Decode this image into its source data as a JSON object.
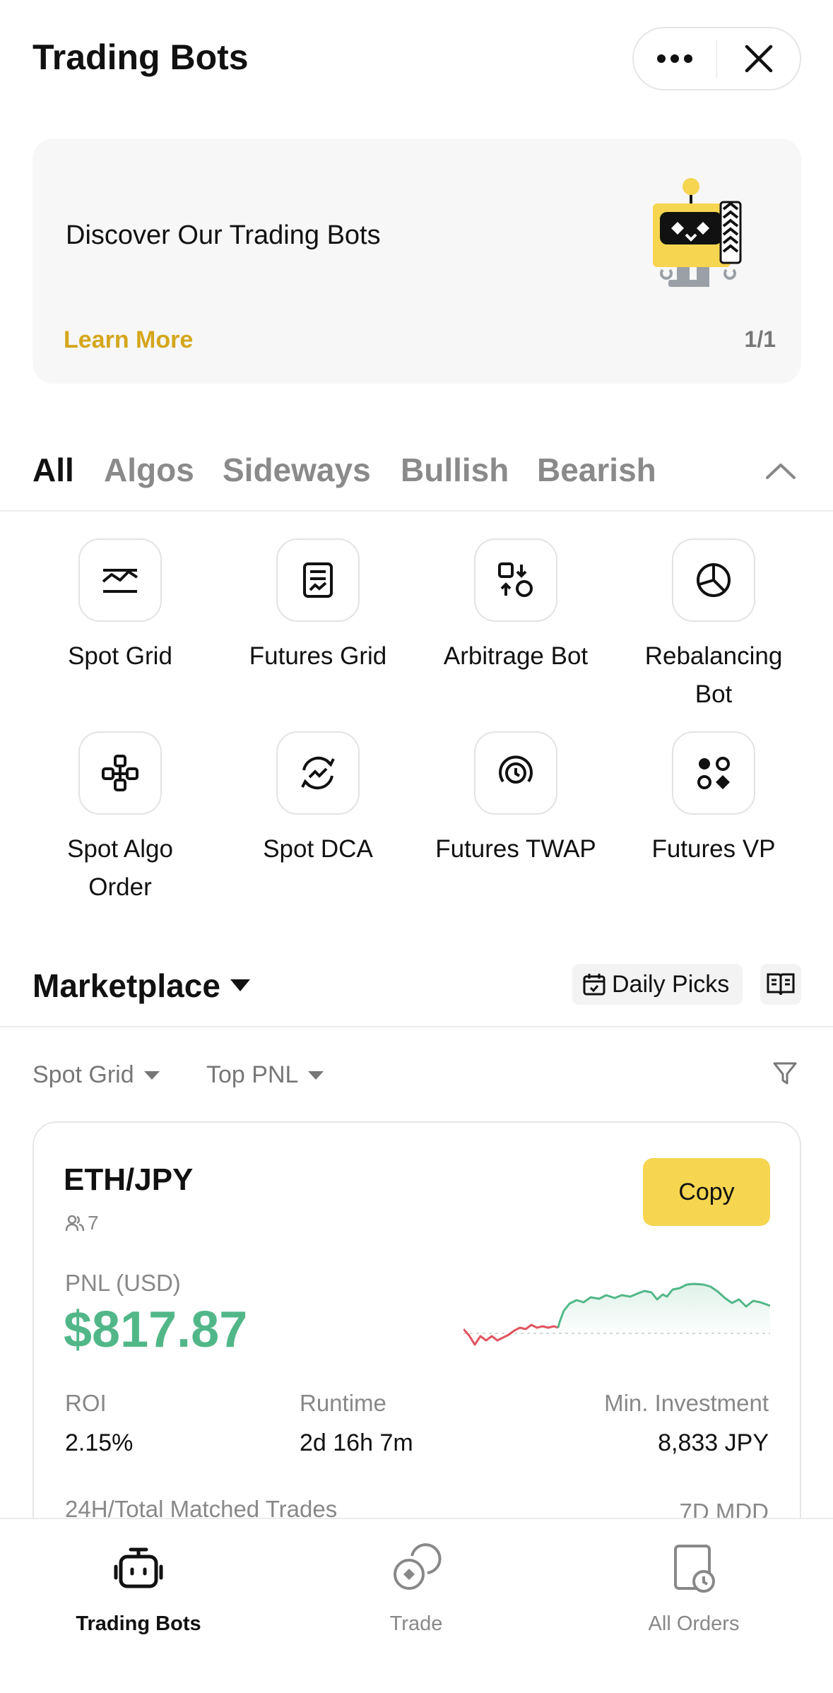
{
  "header": {
    "title": "Trading Bots"
  },
  "banner": {
    "title": "Discover Our Trading Bots",
    "link": "Learn More",
    "page_indicator": "1/1"
  },
  "tabs": [
    "All",
    "Algos",
    "Sideways",
    "Bullish",
    "Bearish"
  ],
  "bots": [
    {
      "label": "Spot Grid",
      "icon": "line-chart-icon"
    },
    {
      "label": "Futures Grid",
      "icon": "document-chart-icon"
    },
    {
      "label": "Arbitrage Bot",
      "icon": "arbitrage-icon"
    },
    {
      "label": "Rebalancing Bot",
      "icon": "pie-chart-icon"
    },
    {
      "label": "Spot Algo Order",
      "icon": "nodes-icon"
    },
    {
      "label": "Spot DCA",
      "icon": "cycle-chart-icon"
    },
    {
      "label": "Futures TWAP",
      "icon": "clock-target-icon"
    },
    {
      "label": "Futures VP",
      "icon": "dots-diamond-icon"
    }
  ],
  "marketplace": {
    "title": "Marketplace",
    "daily_picks": "Daily Picks",
    "filters": {
      "type": "Spot Grid",
      "sort": "Top PNL"
    }
  },
  "card": {
    "pair": "ETH/JPY",
    "users": "7",
    "copy": "Copy",
    "pnl_label": "PNL (USD)",
    "pnl_value": "$817.87",
    "roi_label": "ROI",
    "roi_value": "2.15%",
    "runtime_label": "Runtime",
    "runtime_value": "2d 16h 7m",
    "min_inv_label": "Min. Investment",
    "min_inv_value": "8,833 JPY",
    "trades_label": "24H/Total Matched Trades",
    "mdd_label": "7D MDD",
    "colors": {
      "positive": "#52b788",
      "negative": "#e05561"
    }
  },
  "nav": [
    {
      "label": "Trading Bots",
      "icon": "robot-icon"
    },
    {
      "label": "Trade",
      "icon": "trade-icon"
    },
    {
      "label": "All Orders",
      "icon": "orders-icon"
    }
  ]
}
